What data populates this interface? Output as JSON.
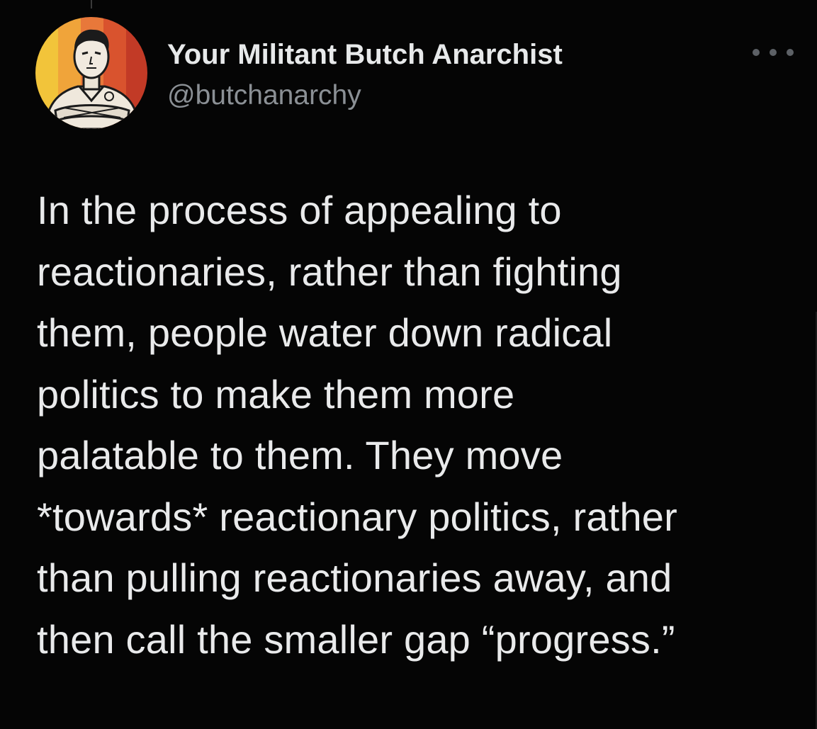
{
  "author": {
    "display_name": "Your Militant Butch Anarchist",
    "handle": "@butchanarchy",
    "avatar_icon": "illustrated-portrait-avatar-icon"
  },
  "menu": {
    "icon": "more-options-icon"
  },
  "tweet": {
    "lines": [
      "In the process of appealing to",
      "reactionaries, rather than fighting",
      "them, people water down radical",
      "politics to make them more",
      "palatable to them. They move",
      "*towards* reactionary politics, rather",
      "than pulling reactionaries away, and",
      "then call the smaller gap “progress.”"
    ]
  },
  "colors": {
    "background": "#050505",
    "text_primary": "#e7e9ea",
    "text_secondary": "#8b9095",
    "avatar_stripes": [
      "#f2c43a",
      "#f0a43a",
      "#e8783a",
      "#d9532e",
      "#c23a26"
    ]
  }
}
